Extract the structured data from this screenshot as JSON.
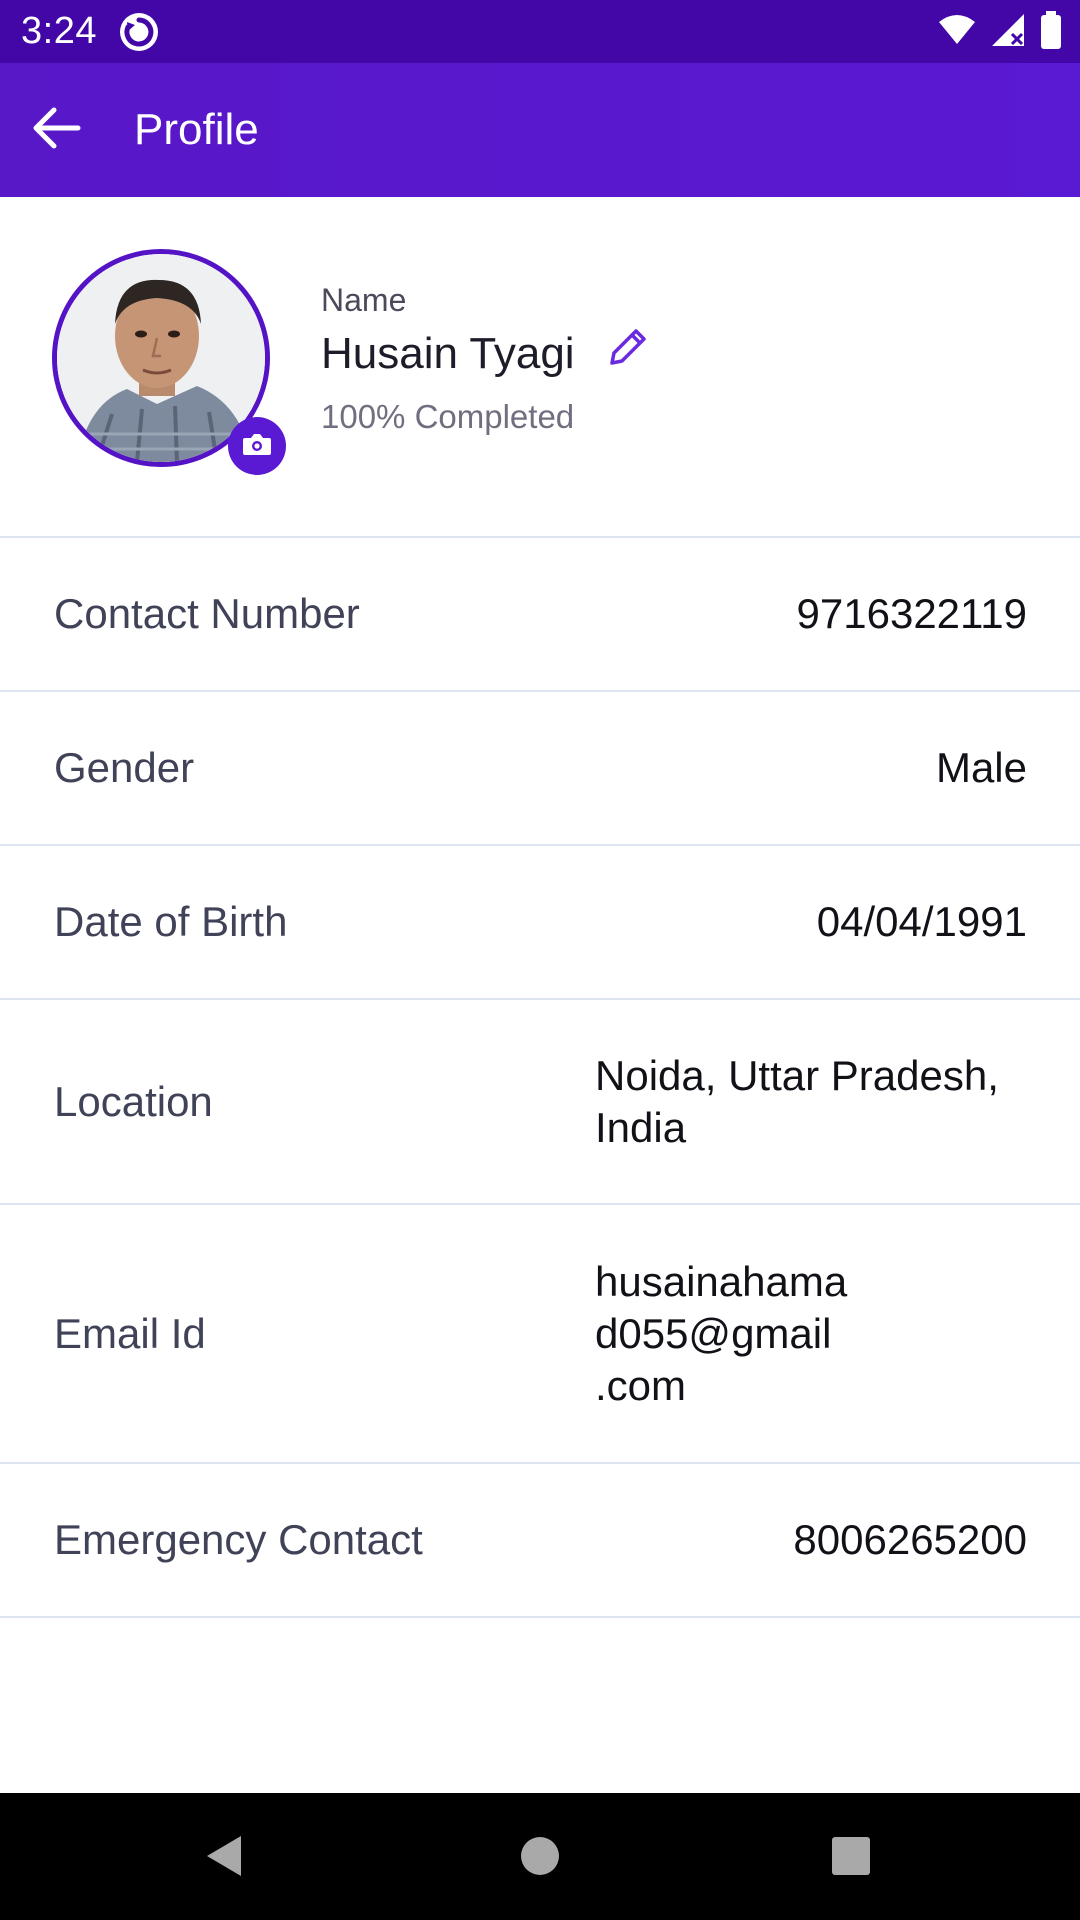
{
  "status_bar": {
    "time": "3:24",
    "app_icon": "sync-app-icon",
    "icons": [
      "wifi-icon",
      "cell-signal-icon",
      "battery-icon"
    ],
    "background": "#4307a8"
  },
  "app_bar": {
    "title": "Profile",
    "back_icon": "arrow-back-icon",
    "background": "#5818c8"
  },
  "profile": {
    "name_label": "Name",
    "name": "Husain Tyagi",
    "completion": "100% Completed",
    "edit_icon": "pencil-icon",
    "camera_icon": "camera-icon",
    "accent": "#5414c6"
  },
  "details": [
    {
      "label": "Contact Number",
      "value": "9716322119"
    },
    {
      "label": "Gender",
      "value": "Male"
    },
    {
      "label": "Date of Birth",
      "value": "04/04/1991"
    },
    {
      "label": "Location",
      "value": "Noida, Uttar Pradesh,\nIndia"
    },
    {
      "label": "Email Id",
      "value": "husainahama\nd055@gmail\n.com"
    },
    {
      "label": "Emergency Contact",
      "value": "8006265200"
    }
  ],
  "nav_bar": {
    "icons": [
      "nav-back-icon",
      "nav-home-icon",
      "nav-recents-icon"
    ]
  }
}
